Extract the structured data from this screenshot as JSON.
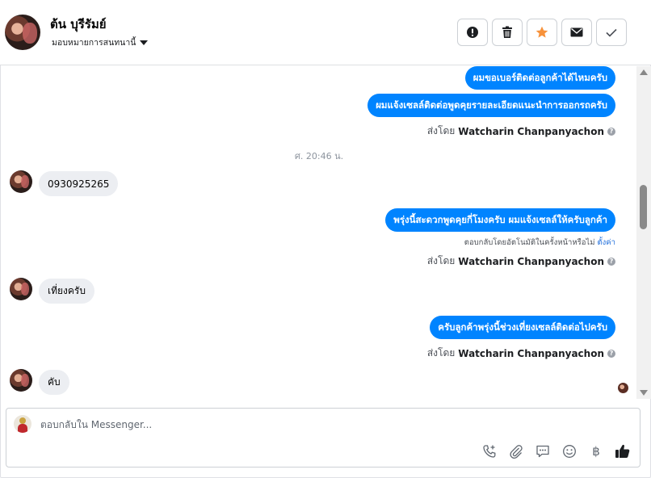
{
  "header": {
    "contact_name": "ต้น บุรีรัมย์",
    "assign_label": "มอบหมายการสนทนานี้",
    "actions": [
      {
        "name": "spam-button",
        "icon": "alert-icon"
      },
      {
        "name": "delete-button",
        "icon": "trash-icon"
      },
      {
        "name": "star-button",
        "icon": "star-icon"
      },
      {
        "name": "mark-unread-button",
        "icon": "envelope-icon"
      },
      {
        "name": "mark-done-button",
        "icon": "check-icon"
      }
    ]
  },
  "messages": {
    "out_1": "ผมขอเบอร์ติดต่อลูกค้าได้ไหมครับ",
    "out_2": "ผมแจ้งเซลล์ติดต่อพูดคุยรายละเอียดแนะนำการออกรถครับ",
    "sent_by_prefix": "ส่งโดย",
    "sent_by_name": "Watcharin Chanpanyachon",
    "time_separator": "ศ. 20:46 น.",
    "in_1": "0930925265",
    "out_3": "พรุ่งนี้สะดวกพูดคุยกี่โมงครับ ผมแจ้งเซลล์ให้ครับลูกค้า",
    "auto_reply_text": "ตอบกลับโดยอัตโนมัติในครั้งหน้าหรือไม่",
    "auto_reply_link": "ตั้งค่า",
    "in_2": "เที่ยงครับ",
    "out_4": "ครับลูกค้าพรุ่งนี้ช่วงเที่ยงเซลล์ติดต่อไปครับ",
    "in_3": "คับ"
  },
  "composer": {
    "placeholder": "ตอบกลับใน Messenger...",
    "currency_symbol": "฿"
  },
  "colors": {
    "accent": "#0084ff",
    "star": "#f7923b"
  }
}
